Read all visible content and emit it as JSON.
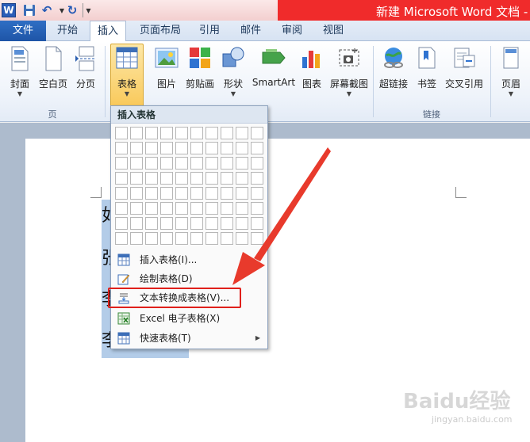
{
  "window": {
    "title": "新建 Microsoft Word 文档 -"
  },
  "qat": {
    "logo": "W"
  },
  "tabs": [
    "文件",
    "开始",
    "插入",
    "页面布局",
    "引用",
    "邮件",
    "审阅",
    "视图"
  ],
  "active_tab": "插入",
  "ribbon": {
    "page_group": {
      "label": "页",
      "buttons": [
        "封面",
        "空白页",
        "分页"
      ]
    },
    "table_button": "表格",
    "illustrations": [
      "图片",
      "剪贴画",
      "形状",
      "SmartArt",
      "图表",
      "屏幕截图"
    ],
    "links_group": {
      "label": "链接",
      "buttons": [
        "超链接",
        "书签",
        "交叉引用"
      ]
    },
    "header_button": "页眉"
  },
  "dropdown": {
    "header": "插入表格",
    "grid": {
      "cols": 10,
      "rows": 8
    },
    "items": [
      {
        "label": "插入表格(I)...",
        "icon": "insert-table-icon"
      },
      {
        "label": "绘制表格(D)",
        "icon": "draw-table-icon"
      },
      {
        "label": "文本转换成表格(V)...",
        "icon": "text-to-table-icon"
      },
      {
        "label": "Excel 电子表格(X)",
        "icon": "excel-icon"
      },
      {
        "label": "快速表格(T)",
        "icon": "quick-table-icon"
      }
    ]
  },
  "document": {
    "selected_lines": [
      "如",
      "张",
      "李",
      "李"
    ]
  },
  "watermark": {
    "text": "Baidu经验",
    "sub": "jingyan.baidu.com"
  },
  "colors": {
    "accent": "#f02b2b",
    "file_tab": "#2f6fc4",
    "highlight": "#e0201b"
  }
}
